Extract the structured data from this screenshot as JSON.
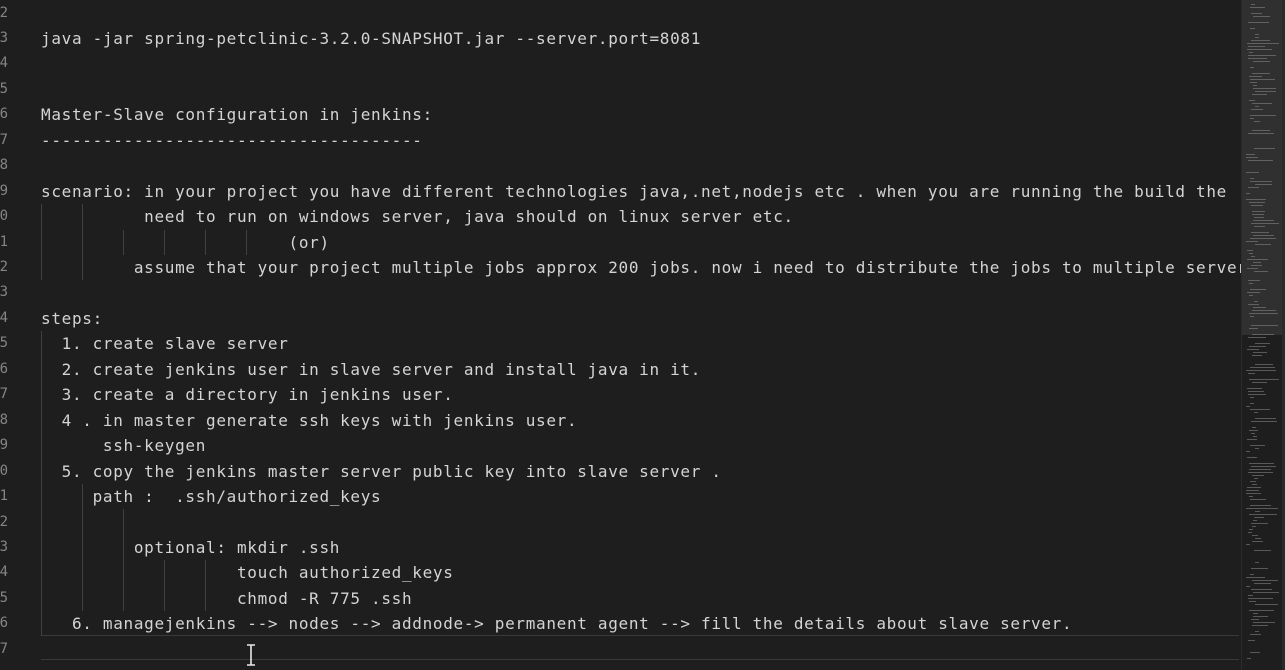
{
  "editor": {
    "line_numbers": [
      "2",
      "3",
      "4",
      "5",
      "6",
      "7",
      "8",
      "9",
      "0",
      "1",
      "2",
      "3",
      "4",
      "5",
      "6",
      "7",
      "8",
      "9",
      "0",
      "1",
      "2",
      "3",
      "4",
      "5",
      "6",
      "7"
    ],
    "lines": [
      "",
      "java -jar spring-petclinic-3.2.0-SNAPSHOT.jar --server.port=8081",
      "",
      "",
      "Master-Slave configuration in jenkins:",
      "-------------------------------------",
      "",
      "scenario: in your project you have different technologies java,.net,nodejs etc . when you are running the build the .",
      "          need to run on windows server, java should on linux server etc.",
      "                        (or)",
      "         assume that your project multiple jobs approx 200 jobs. now i need to distribute the jobs to multiple server",
      "",
      "steps:",
      "  1. create slave server",
      "  2. create jenkins user in slave server and install java in it.",
      "  3. create a directory in jenkins user.",
      "  4 . in master generate ssh keys with jenkins user.",
      "      ssh-keygen",
      "  5. copy the jenkins master server public key into slave server .",
      "     path :  .ssh/authorized_keys",
      "",
      "         optional: mkdir .ssh",
      "                   touch authorized_keys",
      "                   chmod -R 775 .ssh",
      "   6. managejenkins --> nodes --> addnode-> permanent agent --> fill the details about slave server.",
      ""
    ]
  },
  "colors": {
    "background": "#1e1e1e",
    "text": "#d4d4d4",
    "line_number": "#858585",
    "indent_guide": "#404040"
  },
  "icons": {
    "cursor": "i-beam-cursor-icon"
  }
}
